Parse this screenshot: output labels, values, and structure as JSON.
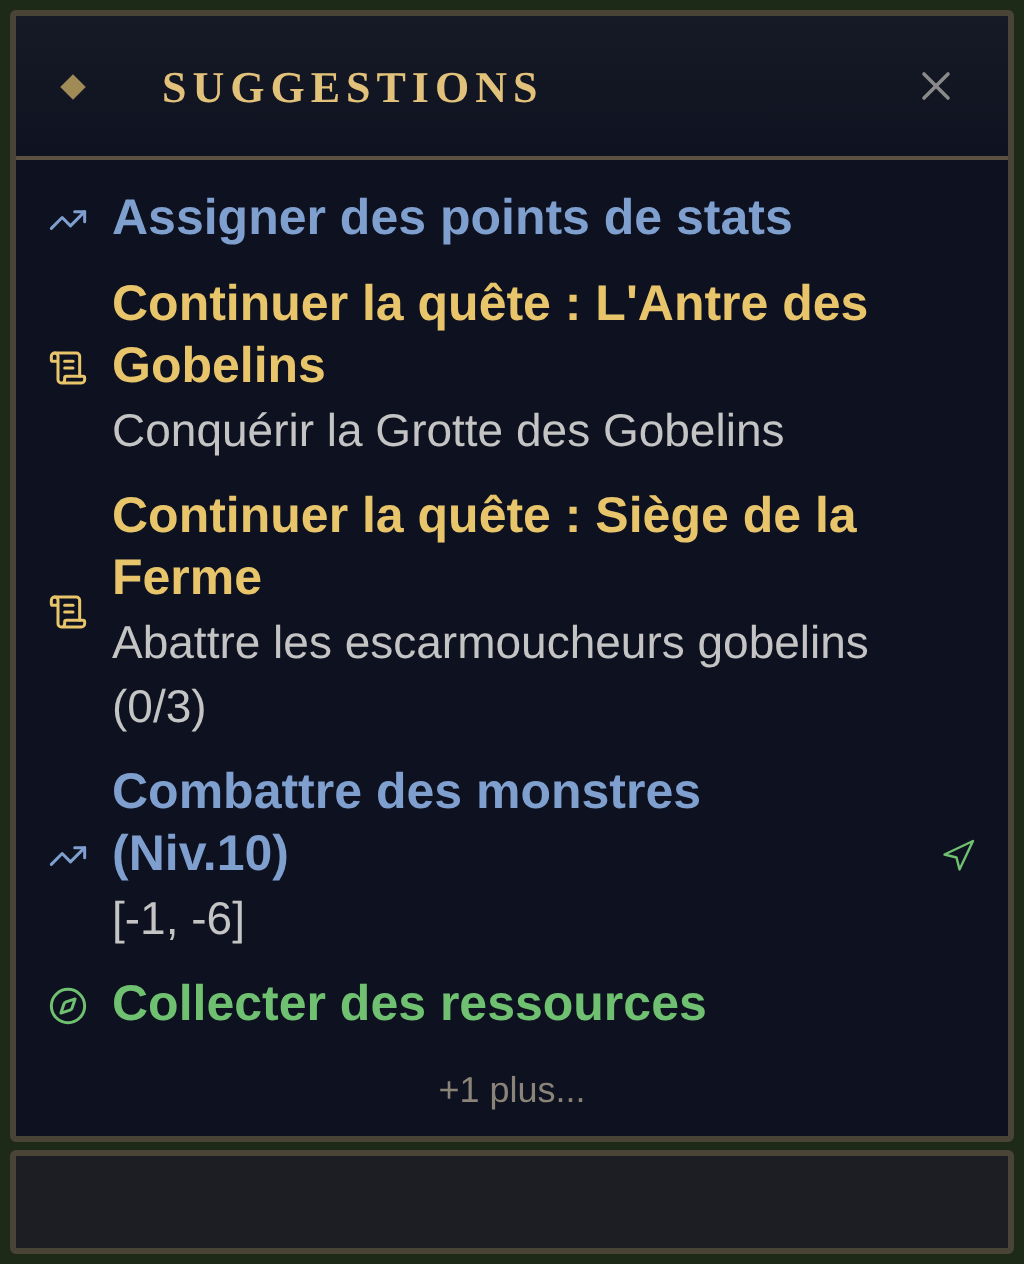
{
  "panel": {
    "title": "SUGGESTIONS"
  },
  "suggestions": [
    {
      "kind": "stats",
      "title": "Assigner des points de stats",
      "navigable": false
    },
    {
      "kind": "quest",
      "title": "Continuer la quête : L'Antre des Gobelins",
      "detail": "Conquérir la Grotte des Gobelins",
      "navigable": false
    },
    {
      "kind": "quest",
      "title": "Continuer la quête : Siège de la Ferme",
      "detail": "Abattre les escarmoucheurs gobelins (0/3)",
      "navigable": false
    },
    {
      "kind": "combat",
      "title": "Combattre des monstres (Niv.10)",
      "detail": "[-1, -6]",
      "navigable": true
    },
    {
      "kind": "gather",
      "title": "Collecter des ressources",
      "navigable": false
    }
  ],
  "more": "+1 plus..."
}
